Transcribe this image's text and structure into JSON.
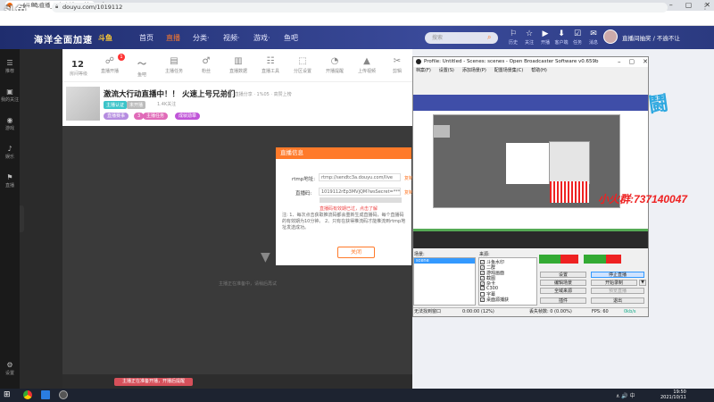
{
  "browser": {
    "tab_title": "...(斗鱼) 直播_斗鱼直播",
    "new_tab": "+",
    "url": "douyu.com/1019112",
    "window_min": "–",
    "window_max": "▢",
    "window_close": "✕",
    "back": "←",
    "forward": "→",
    "reload": "↻",
    "menu": "⋮"
  },
  "watermark": "斗鱼",
  "site": {
    "logo": "海洋全面加速",
    "logo2": "斗鱼",
    "nav": [
      "首页",
      "直播",
      "分类·",
      "视频·",
      "游戏·",
      "鱼吧"
    ],
    "search_placeholder": "搜索",
    "search_icon": "search-icon",
    "header_icons": [
      {
        "glyph": "⚐",
        "label": "历史"
      },
      {
        "glyph": "☆",
        "label": "关注"
      },
      {
        "glyph": "▶",
        "label": "开播"
      },
      {
        "glyph": "⬇",
        "label": "客户端"
      },
      {
        "glyph": "☑",
        "label": "任务"
      },
      {
        "glyph": "✉",
        "label": "消息"
      }
    ],
    "live_label": "直播间抽奖 / 不逾不让"
  },
  "rail": [
    {
      "glyph": "☰",
      "label": "推荐"
    },
    {
      "glyph": "▣",
      "label": "我的关注"
    },
    {
      "glyph": "◉",
      "label": "游戏"
    },
    {
      "glyph": "♪",
      "label": "娱乐"
    },
    {
      "glyph": "⚑",
      "label": "直播"
    },
    {
      "glyph": "⚙",
      "label": "设置"
    }
  ],
  "room": {
    "level": "12",
    "level_label": "房间等级",
    "tools": [
      {
        "glyph": "☍",
        "label": "直播开播"
      },
      {
        "glyph": "〜",
        "label": "鱼吧"
      },
      {
        "glyph": "▤",
        "label": "主播任务"
      },
      {
        "glyph": "♂",
        "label": "粉丝"
      },
      {
        "glyph": "▥",
        "label": "直播数据"
      },
      {
        "glyph": "☷",
        "label": "直播工具"
      },
      {
        "glyph": "⬚",
        "label": "分区设置"
      },
      {
        "glyph": "♕",
        "label": "主播公会"
      },
      {
        "glyph": "◔",
        "label": "开播提醒"
      },
      {
        "glyph": "▲",
        "label": "上传视频"
      },
      {
        "glyph": "✂",
        "label": "剪辑"
      }
    ],
    "badge": "1",
    "title": "激流大行动直播中！！ 火速上号兄弟们",
    "subtitle": "举报 · 直播分享 · 1%05 · 高赞上榜",
    "tags": [
      "主播认证",
      "未开播",
      "关注主播"
    ],
    "meta": "1.4K关注",
    "btn_tags": [
      "直播赛事",
      "3",
      "主播任务",
      "成就勋章"
    ],
    "player_msg": "主播正在准备中，请稍后再试",
    "tip_btn": "主播正在准备开播，开播后提醒"
  },
  "modal": {
    "header": "直播信息",
    "rtmp_label": "rtmp地址:",
    "rtmp_value": "rtmp://sendtc3a.douyu.com/live",
    "key_label": "直播码:",
    "key_value": "1019112rEp3MVjQM?wsSecret=*******",
    "copy": "复制",
    "warn": "直播码有效期已过，点击了解",
    "notes": "注: 1、每次点击获取推流码都会重新生成直播码，每个直播码的有效期为10分钟。 2、只有在获得推流码才能推流到rtmp地址发送成功。",
    "close_btn": "关闭"
  },
  "obs": {
    "title": "Profile: Untitled - Scenes: scenes - Open Broadcaster Software v0.659b",
    "menu": [
      "档案(F)",
      "设置(S)",
      "添加场景(P)",
      "配置场景集(C)",
      "帮助(H)"
    ],
    "overlay_text": "小火群:737140047",
    "scenes_label": "场景:",
    "scene_selected": "scene",
    "sources_label": "来源:",
    "sources": [
      "斗鱼水印",
      "二群",
      "游戏画面",
      "截图",
      "杂卡",
      "C300",
      "字幕",
      "桌面源捕获"
    ],
    "buttons": [
      "设置",
      "停止直播",
      "编辑场景",
      "开始录制",
      "全域来源",
      "预览直播",
      "插件",
      "退出"
    ],
    "status": {
      "window": "无法找到窗口",
      "time": "0:00:00 (12%)",
      "dropped": "丢失帧数: 0 (0.00%)",
      "fps": "FPS: 60",
      "bitrate": "0kb/s"
    }
  },
  "taskbar": {
    "time": "19:50",
    "date": "2021/10/11",
    "tray": "∧ 🔊 中"
  }
}
